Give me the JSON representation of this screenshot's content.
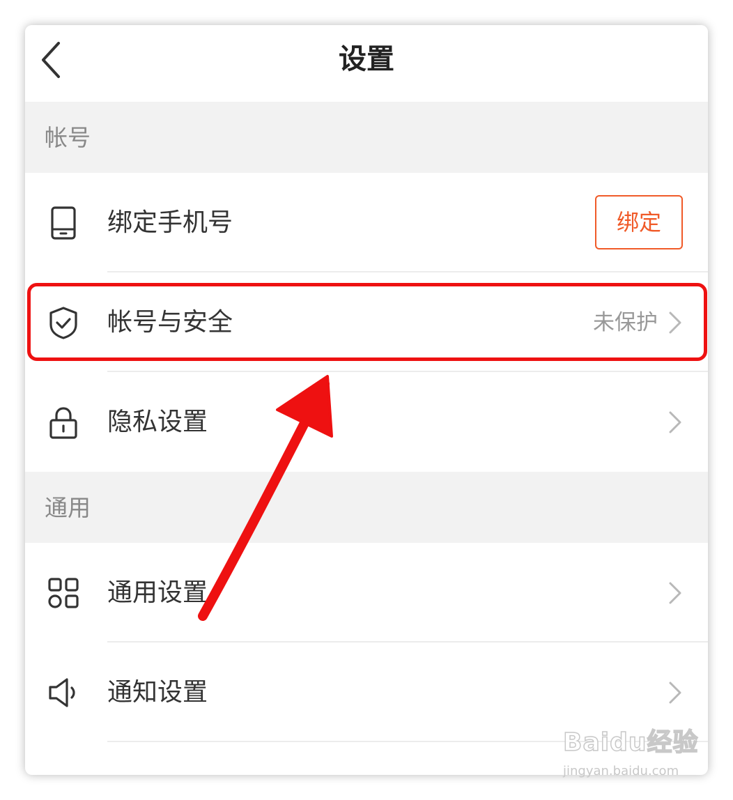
{
  "header": {
    "title": "设置",
    "back_icon": "chevron-left-icon"
  },
  "sections": [
    {
      "title": "帐号",
      "items": [
        {
          "label": "绑定手机号",
          "icon": "phone-icon",
          "action_label": "绑定"
        },
        {
          "label": "帐号与安全",
          "icon": "shield-check-icon",
          "value": "未保护",
          "highlighted": true
        },
        {
          "label": "隐私设置",
          "icon": "lock-icon"
        }
      ]
    },
    {
      "title": "通用",
      "items": [
        {
          "label": "通用设置",
          "icon": "grid-icon"
        },
        {
          "label": "通知设置",
          "icon": "speaker-icon"
        }
      ]
    }
  ],
  "colors": {
    "accent": "#f05a28",
    "annotation_red": "#ee1111",
    "section_bg": "#f2f2f2",
    "secondary_text": "#999999"
  },
  "watermark": {
    "brand": "Baidu经验",
    "domain": "jingyan.baidu.com"
  }
}
